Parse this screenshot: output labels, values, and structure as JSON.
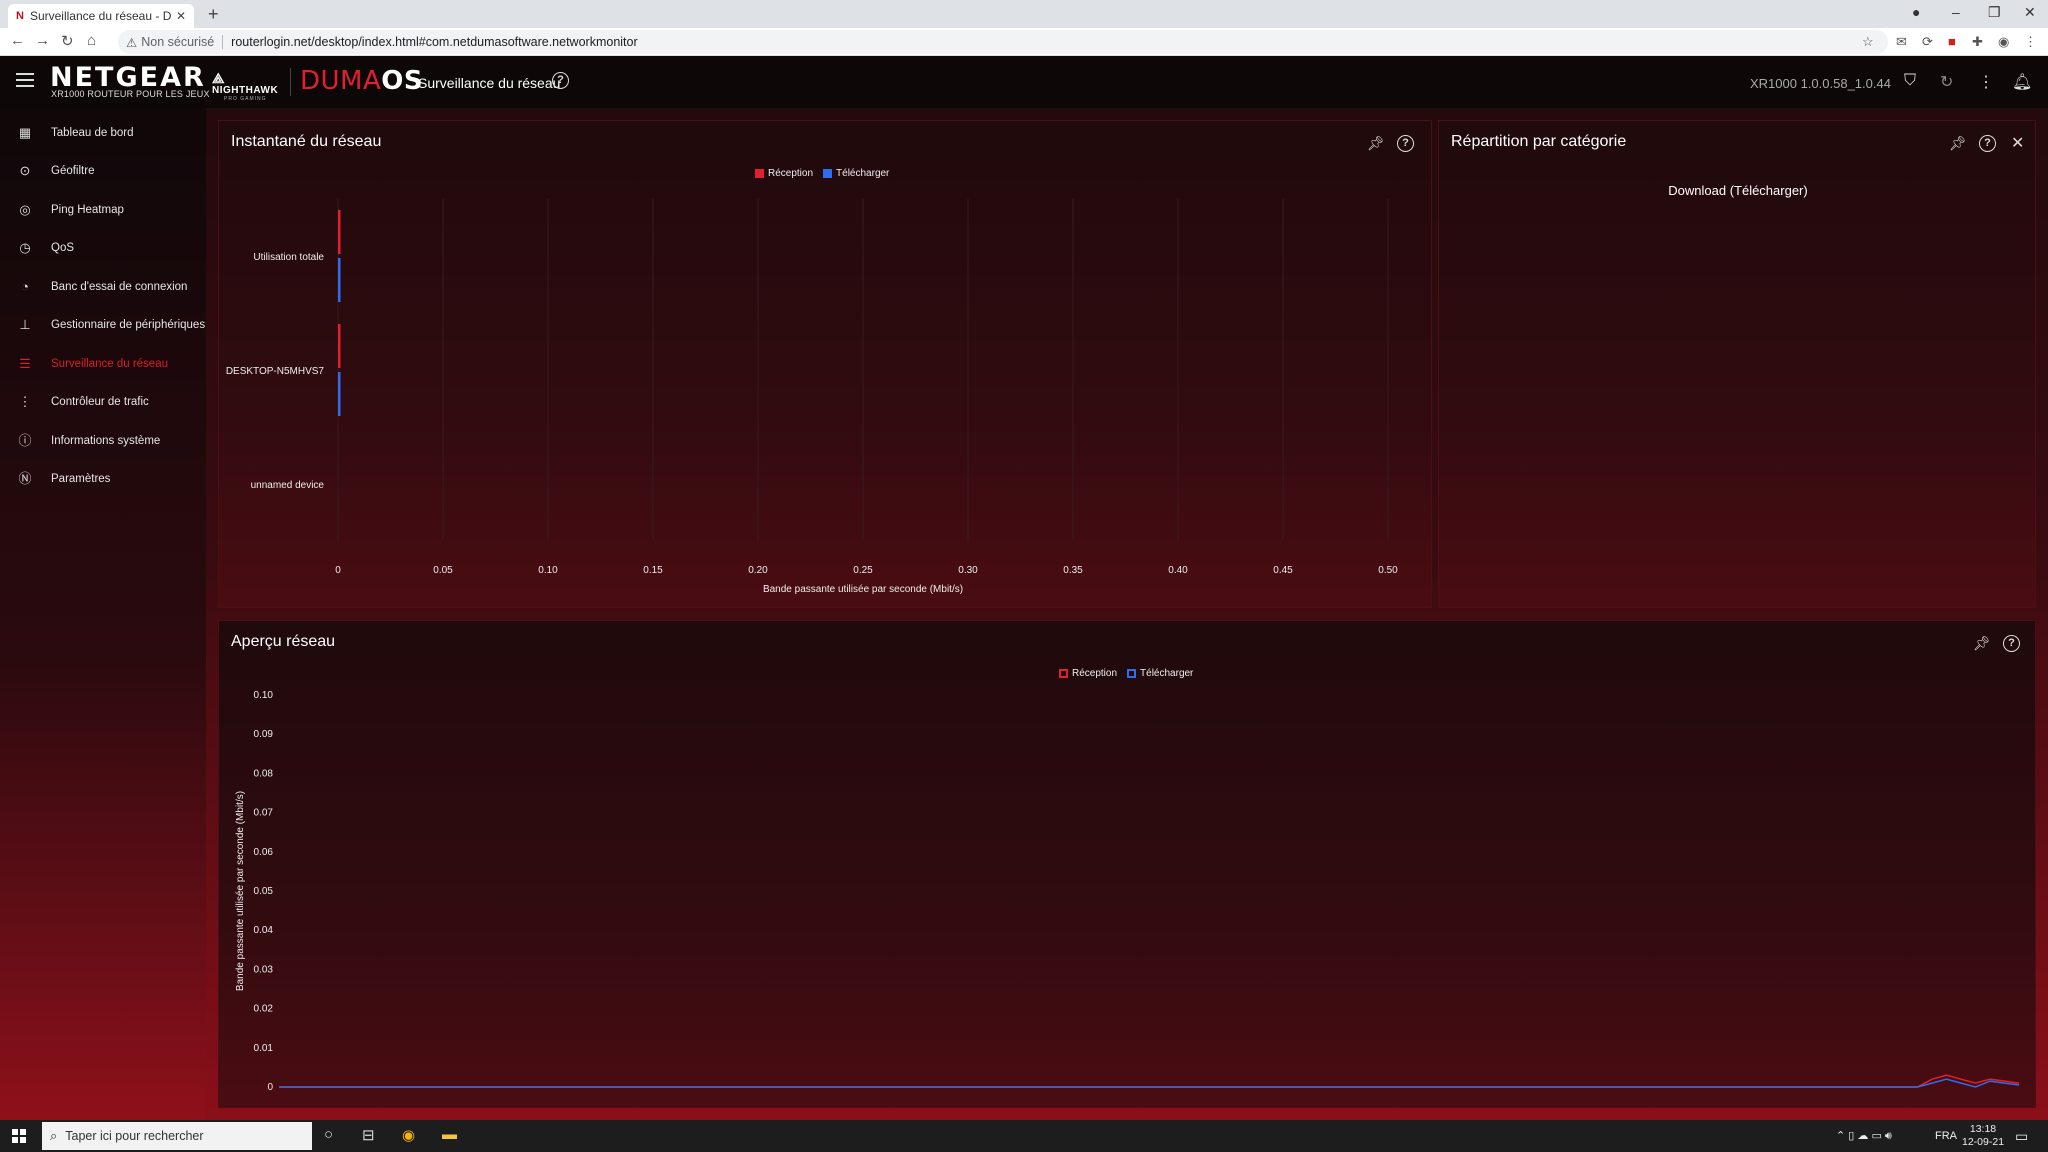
{
  "browser": {
    "tab_title": "Surveillance du réseau - DumaO",
    "tab_favicon": "N",
    "security_label": "Non sécurisé",
    "url": "routerlogin.net/desktop/index.html#com.netdumasoftware.networkmonitor"
  },
  "header": {
    "brand": "NETGEAR",
    "brand_sub": "XR1000 ROUTEUR POUR LES JEUX",
    "nighthawk": "NIGHTHAWK",
    "nighthawk_sub": "PRO GAMING",
    "duma_prefix": "DUMA",
    "duma_suffix": "OS",
    "page_title": "Surveillance du réseau",
    "firmware": "XR1000 1.0.0.58_1.0.44"
  },
  "sidebar": {
    "items": [
      {
        "label": "Tableau de bord",
        "icon": "dashboard-icon"
      },
      {
        "label": "Géofiltre",
        "icon": "geofilter-icon"
      },
      {
        "label": "Ping Heatmap",
        "icon": "ping-heatmap-icon"
      },
      {
        "label": "QoS",
        "icon": "qos-icon"
      },
      {
        "label": "Banc d'essai de connexion",
        "icon": "speedtest-icon"
      },
      {
        "label": "Gestionnaire de périphériques",
        "icon": "device-manager-icon"
      },
      {
        "label": "Surveillance du réseau",
        "icon": "network-monitor-icon",
        "active": true
      },
      {
        "label": "Contrôleur de trafic",
        "icon": "traffic-controller-icon"
      },
      {
        "label": "Informations système",
        "icon": "system-info-icon"
      },
      {
        "label": "Paramètres",
        "icon": "settings-icon"
      }
    ]
  },
  "snapshot_panel": {
    "title": "Instantané du réseau",
    "legend": [
      {
        "label": "Réception",
        "color": "#e0202e"
      },
      {
        "label": "Télécharger",
        "color": "#2e6df0"
      }
    ]
  },
  "category_panel": {
    "title": "Répartition par catégorie",
    "subtitle": "Download (Télécharger)"
  },
  "overview_panel": {
    "title": "Aperçu réseau",
    "legend": [
      {
        "label": "Réception",
        "color": "#e0202e"
      },
      {
        "label": "Télécharger",
        "color": "#2e6df0"
      }
    ]
  },
  "chart_data": [
    {
      "type": "bar",
      "orientation": "horizontal",
      "categories": [
        "Utilisation totale",
        "DESKTOP-N5MHVS7",
        "unnamed device"
      ],
      "series": [
        {
          "name": "Réception",
          "values": [
            0.001,
            0.001,
            0
          ]
        },
        {
          "name": "Télécharger",
          "values": [
            0.001,
            0.001,
            0
          ]
        }
      ],
      "xlabel": "Bande passante utilisée par seconde (Mbit/s)",
      "ylabel": "",
      "xlim": [
        0,
        0.5
      ],
      "xticks": [
        "0",
        "0.05",
        "0.10",
        "0.15",
        "0.20",
        "0.25",
        "0.30",
        "0.35",
        "0.40",
        "0.45",
        "0.50"
      ],
      "colors": [
        "#e0202e",
        "#2e6df0"
      ],
      "grid": true,
      "legend": "top-center"
    },
    {
      "type": "line",
      "x_count": 120,
      "series": [
        {
          "name": "Réception",
          "points": [
            [
              0,
              0
            ],
            [
              113,
              0
            ],
            [
              114,
              0.002
            ],
            [
              115,
              0.003
            ],
            [
              116,
              0.002
            ],
            [
              117,
              0.001
            ],
            [
              118,
              0.002
            ],
            [
              119,
              0.0015
            ],
            [
              120,
              0.001
            ]
          ]
        },
        {
          "name": "Télécharger",
          "points": [
            [
              0,
              0
            ],
            [
              113,
              0
            ],
            [
              114,
              0.001
            ],
            [
              115,
              0.002
            ],
            [
              116,
              0.001
            ],
            [
              117,
              0
            ],
            [
              118,
              0.0015
            ],
            [
              119,
              0.001
            ],
            [
              120,
              0.0005
            ]
          ]
        }
      ],
      "xlabel": "",
      "ylabel": "Bande passante utilisée par seconde (Mbit/s)",
      "ylim": [
        0,
        0.1
      ],
      "yticks": [
        "0",
        "0.01",
        "0.02",
        "0.03",
        "0.04",
        "0.05",
        "0.06",
        "0.07",
        "0.08",
        "0.09",
        "0.10"
      ],
      "colors": [
        "#e0202e",
        "#2e6df0"
      ],
      "grid": false,
      "legend": "top-center"
    }
  ],
  "taskbar": {
    "search_placeholder": "Taper ici pour rechercher",
    "language": "FRA",
    "time": "13:18",
    "date": "12-09-21"
  }
}
